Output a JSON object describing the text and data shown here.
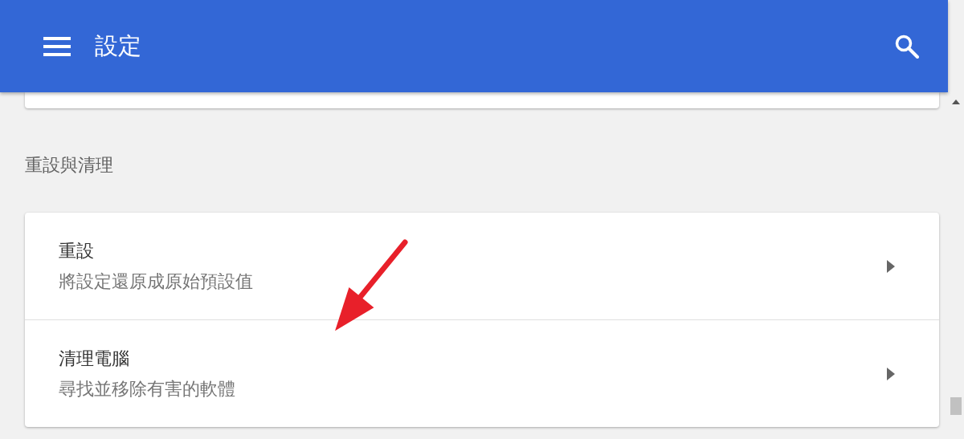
{
  "header": {
    "title": "設定"
  },
  "section": {
    "title": "重設與清理"
  },
  "rows": [
    {
      "title": "重設",
      "subtitle": "將設定還原成原始預設值"
    },
    {
      "title": "清理電腦",
      "subtitle": "尋找並移除有害的軟體"
    }
  ]
}
